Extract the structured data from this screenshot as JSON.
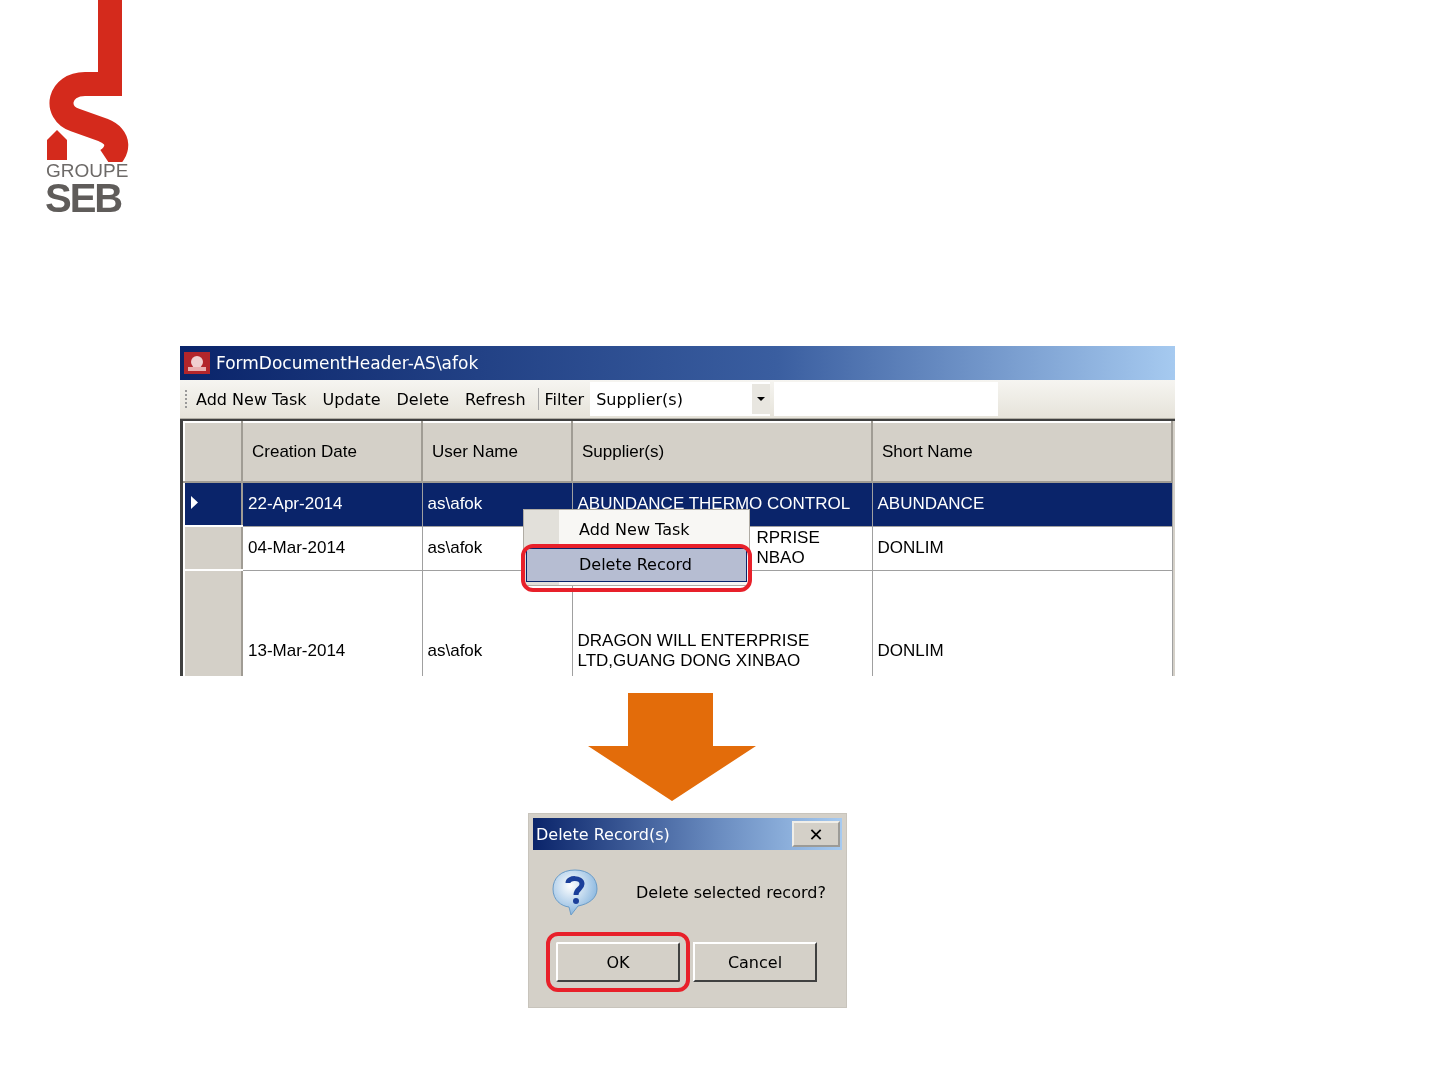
{
  "logo": {
    "line_1": "GROUPE",
    "line_2": "SEB"
  },
  "window": {
    "title": "FormDocumentHeader-AS\\afok"
  },
  "toolbar": {
    "buttons": [
      "Add New Task",
      "Update",
      "Delete",
      "Refresh"
    ],
    "filter_label": "Filter",
    "filter_combo": {
      "value": "Supplier(s)"
    }
  },
  "table": {
    "columns": [
      "Creation Date",
      "User Name",
      "Supplier(s)",
      "Short Name"
    ],
    "rows": [
      {
        "selected": true,
        "covered_by_menu": false,
        "cells": [
          "22-Apr-2014",
          "as\\afok",
          "ABUNDANCE THERMO CONTROL",
          "ABUNDANCE"
        ]
      },
      {
        "selected": false,
        "covered_by_menu": true,
        "cells": [
          "04-Mar-2014",
          "as\\afok",
          "RPRISE\nNBAO",
          "DONLIM"
        ]
      },
      {
        "selected": false,
        "covered_by_menu": false,
        "cells": [
          "13-Mar-2014",
          "as\\afok",
          "DRAGON WILL ENTERPRISE\nLTD,GUANG DONG XINBAO",
          "DONLIM"
        ]
      }
    ]
  },
  "context_menu": {
    "items": [
      {
        "label": "Add New Task",
        "selected": false,
        "circled": false
      },
      {
        "label": "Delete Record",
        "selected": true,
        "circled": true
      }
    ]
  },
  "dialog": {
    "title": "Delete Record(s)",
    "close": "✕",
    "message": "Delete selected record?",
    "buttons": [
      {
        "label": "OK",
        "circled": true
      },
      {
        "label": "Cancel",
        "circled": false
      }
    ]
  }
}
